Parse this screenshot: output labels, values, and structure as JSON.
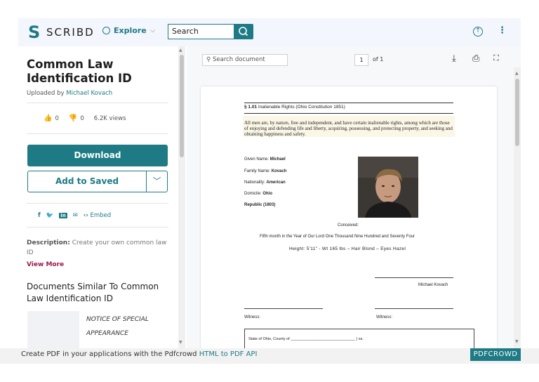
{
  "header": {
    "logo_text": "SCRIBD",
    "explore_label": "Explore",
    "search_placeholder": "Search",
    "icons": [
      "scribd-logo-icon",
      "compass-icon",
      "chevron-down-icon",
      "search-icon",
      "upload-icon",
      "more-vertical-icon"
    ]
  },
  "document": {
    "title": "Common Law Identification ID",
    "uploaded_by_prefix": "Uploaded by",
    "uploader": "Michael Kovach",
    "likes": "0",
    "dislikes": "0",
    "views": "6.2K views",
    "download_label": "Download",
    "add_to_saved_label": "Add to Saved",
    "embed_label": "Embed",
    "description_label": "Description:",
    "description_text": "Create your own common law ID",
    "view_more_label": "View More",
    "similar_heading": "Documents Similar To Common Law Identification ID",
    "similar_items": [
      {
        "title": "NOTICE OF SPECIAL APPEARANCE"
      }
    ]
  },
  "viewer": {
    "search_placeholder": "Search document",
    "page_current": "1",
    "page_of": "of 1"
  },
  "page": {
    "section_number": "§ 1.01",
    "section_title": "Inalienable Rights (Ohio Constitution 1851)",
    "rights_text": "All men are, by nature, free and independent, and have certain inalienable rights, among which are those of enjoying and defending life and liberty, acquiring, possessing, and protecting property, and seeking and obtaining happiness and safety.",
    "fields": [
      {
        "label": "Given Name:",
        "value": "Michael"
      },
      {
        "label": "Family Name:",
        "value": "Kovach"
      },
      {
        "label": "Nationality:",
        "value": "American"
      },
      {
        "label": "Domicile:",
        "value": "Ohio"
      },
      {
        "label": "",
        "value": "Republic (1803)"
      }
    ],
    "conceived": "Conceived:",
    "fifth_month": "Fifth month in the Year of Our Lord One Thousand Nine Hundred and Seventy Four",
    "height_line": "Height: 5'11\" - Wt 165 lbs – Hair Blond – Eyes Hazel",
    "signature_name": "Michael Kovach",
    "witness_left": "Witness:",
    "witness_right": "Witness:",
    "state_line": "State of Ohio, County of ______________________________ ) ss."
  },
  "footer": {
    "text": "Create PDF in your applications with the Pdfcrowd",
    "link": "HTML to PDF API",
    "brand": "PDFCROWD"
  },
  "colors": {
    "accent": "#1e7b85",
    "view_more": "#9b1b4e",
    "thumb": "#e89a25"
  }
}
